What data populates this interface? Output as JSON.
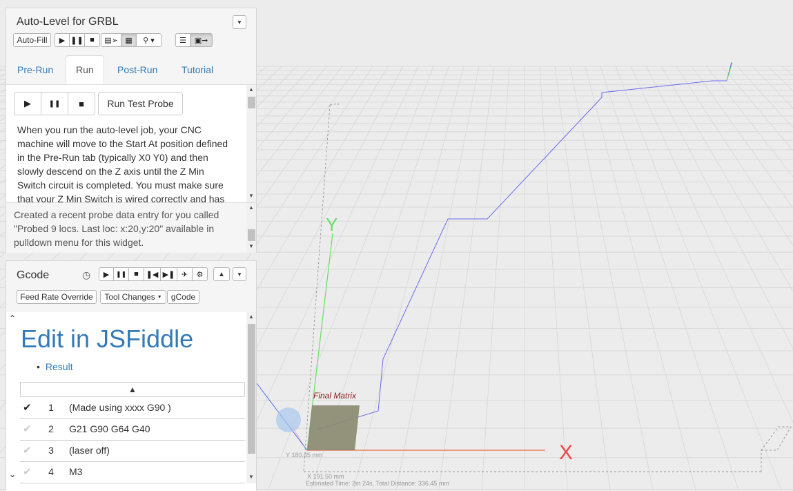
{
  "autolevel": {
    "title": "Auto-Level for GRBL",
    "autofill_label": "Auto-Fill",
    "tabs": [
      {
        "label": "Pre-Run"
      },
      {
        "label": "Run"
      },
      {
        "label": "Post-Run"
      },
      {
        "label": "Tutorial"
      }
    ],
    "run_test_probe_label": "Run Test Probe",
    "description": "When you run the auto-level job, your CNC machine will move to the Start At position defined in the Pre-Run tab (typically X0 Y0) and then slowly descend on the Z axis until the Z Min Switch circuit is completed. You must make sure that your Z Min Switch is wired correctly and has",
    "status_message": "Created a recent probe data entry for you called \"Probed 9 locs. Last loc: x:20,y:20\" available in pulldown menu for this widget."
  },
  "gcode": {
    "title": "Gcode",
    "feed_rate_label": "Feed Rate Override",
    "tool_changes_label": "Tool Changes",
    "gcode_label": "gCode",
    "heading": "Edit in JSFiddle",
    "result_link": "Result",
    "lines": [
      {
        "num": "1",
        "code": "(Made using xxxx G90 )",
        "checked": true
      },
      {
        "num": "2",
        "code": "G21 G90 G64 G40",
        "checked": false
      },
      {
        "num": "3",
        "code": "(laser off)",
        "checked": false
      },
      {
        "num": "4",
        "code": "M3",
        "checked": false
      }
    ]
  },
  "scene": {
    "y_axis_label": "Y",
    "x_axis_label": "X",
    "matrix_label": "Final Matrix",
    "y_dimension": "Y 180.45 mm",
    "x_dimension": "X 191.50 mm",
    "estimate": "Estimated Time: 2m 24s, Total Distance: 336.45 mm"
  },
  "colors": {
    "link": "#337ab7",
    "toolpath": "#6a6aee",
    "y_axis": "#66dd66",
    "x_axis": "#ee4444"
  }
}
